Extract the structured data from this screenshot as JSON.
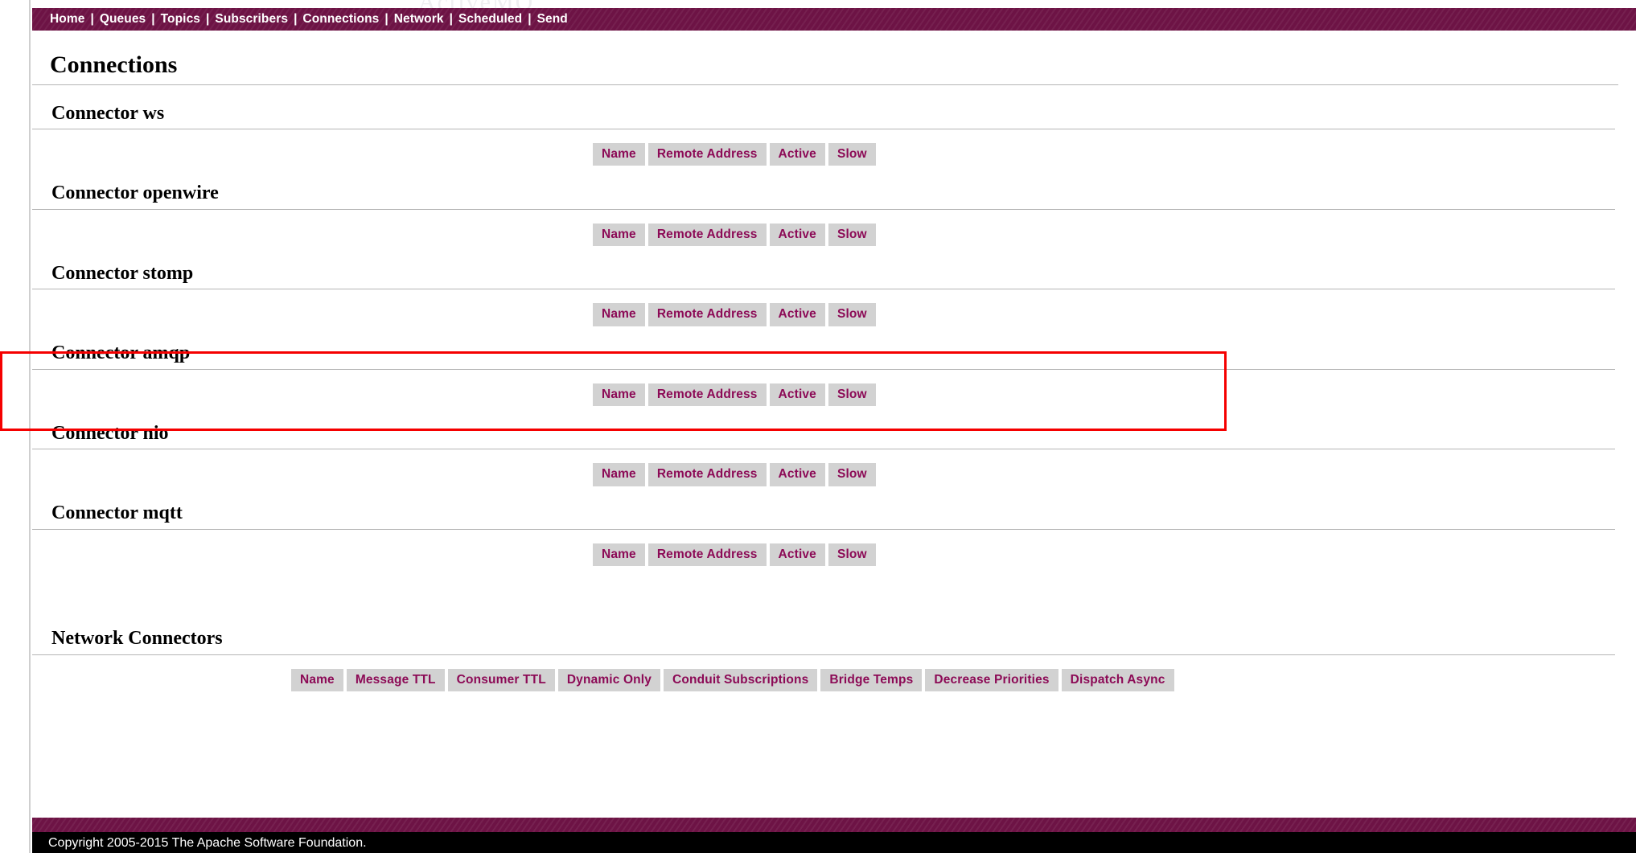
{
  "nav": {
    "separator": "|",
    "items": [
      {
        "label": "Home",
        "name": "nav-home"
      },
      {
        "label": "Queues",
        "name": "nav-queues"
      },
      {
        "label": "Topics",
        "name": "nav-topics"
      },
      {
        "label": "Subscribers",
        "name": "nav-subscribers"
      },
      {
        "label": "Connections",
        "name": "nav-connections"
      },
      {
        "label": "Network",
        "name": "nav-network"
      },
      {
        "label": "Scheduled",
        "name": "nav-scheduled"
      },
      {
        "label": "Send",
        "name": "nav-send"
      }
    ]
  },
  "page": {
    "title": "Connections",
    "watermark_text": "ActiveMQ"
  },
  "connector_columns": [
    "Name",
    "Remote Address",
    "Active",
    "Slow"
  ],
  "connectors": [
    {
      "title": "Connector ws"
    },
    {
      "title": "Connector openwire"
    },
    {
      "title": "Connector stomp"
    },
    {
      "title": "Connector amqp"
    },
    {
      "title": "Connector nio"
    },
    {
      "title": "Connector mqtt"
    }
  ],
  "network_connectors": {
    "title": "Network Connectors",
    "columns": [
      "Name",
      "Message TTL",
      "Consumer TTL",
      "Dynamic Only",
      "Conduit Subscriptions",
      "Bridge Temps",
      "Decrease Priorities",
      "Dispatch Async"
    ]
  },
  "footer": {
    "copyright": "Copyright 2005-2015 The Apache Software Foundation."
  },
  "colors": {
    "brand_maroon": "#6d1345",
    "header_text": "#8c0a56",
    "header_cell_bg": "#d2d2d2",
    "annotation_red": "#f50000",
    "rule_grey": "#b5b5b5"
  }
}
